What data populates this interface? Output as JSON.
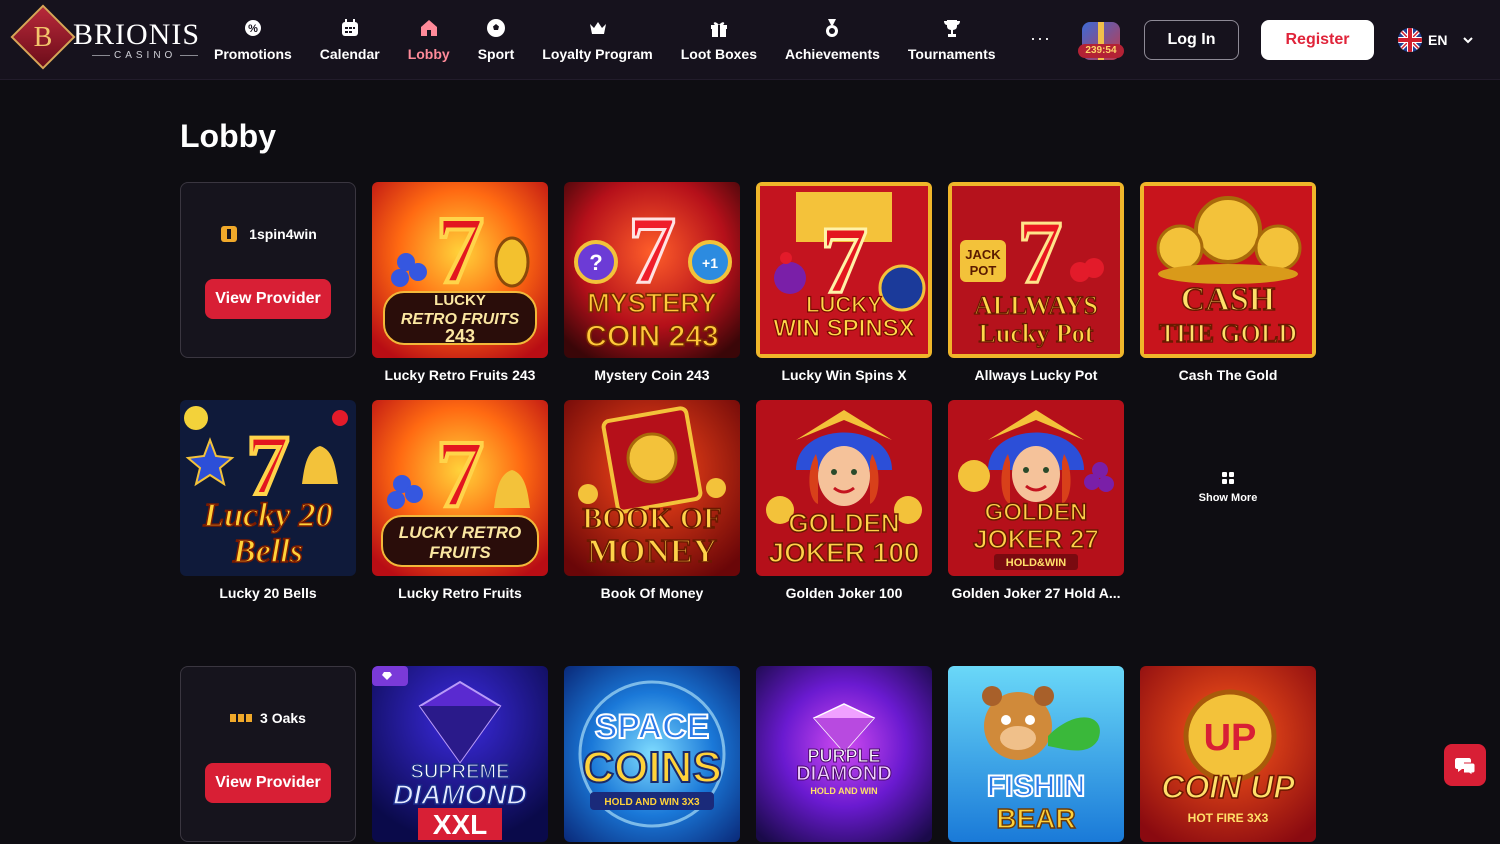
{
  "brand": {
    "name": "BRIONIS",
    "sub": "CASINO",
    "initial": "B"
  },
  "nav": [
    {
      "label": "Promotions",
      "icon": "promotions-icon"
    },
    {
      "label": "Calendar",
      "icon": "calendar-icon"
    },
    {
      "label": "Lobby",
      "icon": "home-icon",
      "active": true
    },
    {
      "label": "Sport",
      "icon": "soccer-ball-icon"
    },
    {
      "label": "Loyalty Program",
      "icon": "crown-icon"
    },
    {
      "label": "Loot Boxes",
      "icon": "gift-icon"
    },
    {
      "label": "Achievements",
      "icon": "medal-icon"
    },
    {
      "label": "Tournaments",
      "icon": "trophy-icon"
    }
  ],
  "more_label": "···",
  "lootbox_timer": "239:54",
  "auth": {
    "login": "Log In",
    "register": "Register"
  },
  "language": {
    "code": "EN"
  },
  "page_title": "Lobby",
  "providers": [
    {
      "name": "1spin4win",
      "button": "View Provider"
    },
    {
      "name": "3 Oaks",
      "button": "View Provider"
    }
  ],
  "games_row1": [
    {
      "name": "Lucky Retro Fruits 243",
      "art": [
        "LUCKY",
        "RETRO FRUITS",
        "243"
      ]
    },
    {
      "name": "Mystery Coin 243",
      "art": [
        "MYSTERY",
        "COIN 243"
      ]
    },
    {
      "name": "Lucky Win Spins X",
      "art": [
        "LUCKY",
        "WIN SPINSX"
      ]
    },
    {
      "name": "Allways Lucky Pot",
      "art": [
        "ALLWAYS",
        "Lucky Pot"
      ]
    },
    {
      "name": "Cash The Gold",
      "art": [
        "CASH",
        "THE GOLD"
      ]
    }
  ],
  "games_row2": [
    {
      "name": "Lucky 20 Bells",
      "art": [
        "Lucky 20",
        "Bells"
      ]
    },
    {
      "name": "Lucky Retro Fruits",
      "art": [
        "LUCKY RETRO",
        "FRUITS"
      ]
    },
    {
      "name": "Book Of Money",
      "art": [
        "BOOK OF",
        "MONEY"
      ]
    },
    {
      "name": "Golden Joker 100",
      "art": [
        "GOLDEN",
        "JOKER 100"
      ]
    },
    {
      "name": "Golden Joker 27 Hold A...",
      "art": [
        "GOLDEN",
        "JOKER 27",
        "HOLD&WIN"
      ]
    }
  ],
  "show_more": "Show More",
  "games_row3": [
    {
      "name": "Supreme Diamond XXL",
      "art": [
        "SUPREME",
        "DIAMOND",
        "XXL"
      ]
    },
    {
      "name": "Space Coins",
      "art": [
        "SPACE",
        "COINS",
        "HOLD AND WIN 3X3"
      ]
    },
    {
      "name": "Purple Diamond",
      "art": [
        "PURPLE",
        "DIAMOND",
        "HOLD AND WIN"
      ]
    },
    {
      "name": "Fishin Bear",
      "art": [
        "FISHIN",
        "BEAR"
      ]
    },
    {
      "name": "Coin Up",
      "art": [
        "COIN UP",
        "HOT FIRE 3X3"
      ]
    }
  ],
  "colors": {
    "accent": "#d81f35",
    "background": "#0e0d12",
    "header": "#16121d",
    "active_nav": "#ff8a99"
  }
}
